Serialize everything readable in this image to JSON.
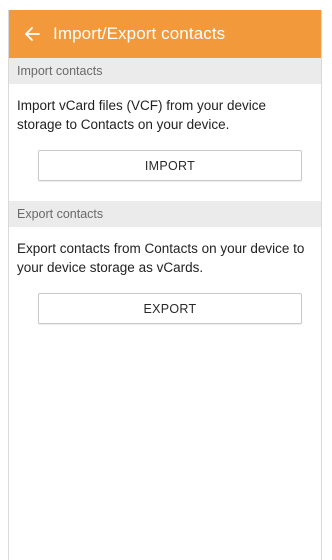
{
  "header": {
    "title": "Import/Export contacts",
    "back_icon": "arrow-left-icon"
  },
  "import_section": {
    "header": "Import contacts",
    "description": "Import vCard files (VCF) from your device storage to Contacts on your device.",
    "button_label": "IMPORT"
  },
  "export_section": {
    "header": "Export contacts",
    "description": "Export contacts from Contacts on your device to your device storage as vCards.",
    "button_label": "EXPORT"
  },
  "colors": {
    "app_bar": "#f29a3b",
    "section_header_bg": "#ebebeb"
  }
}
